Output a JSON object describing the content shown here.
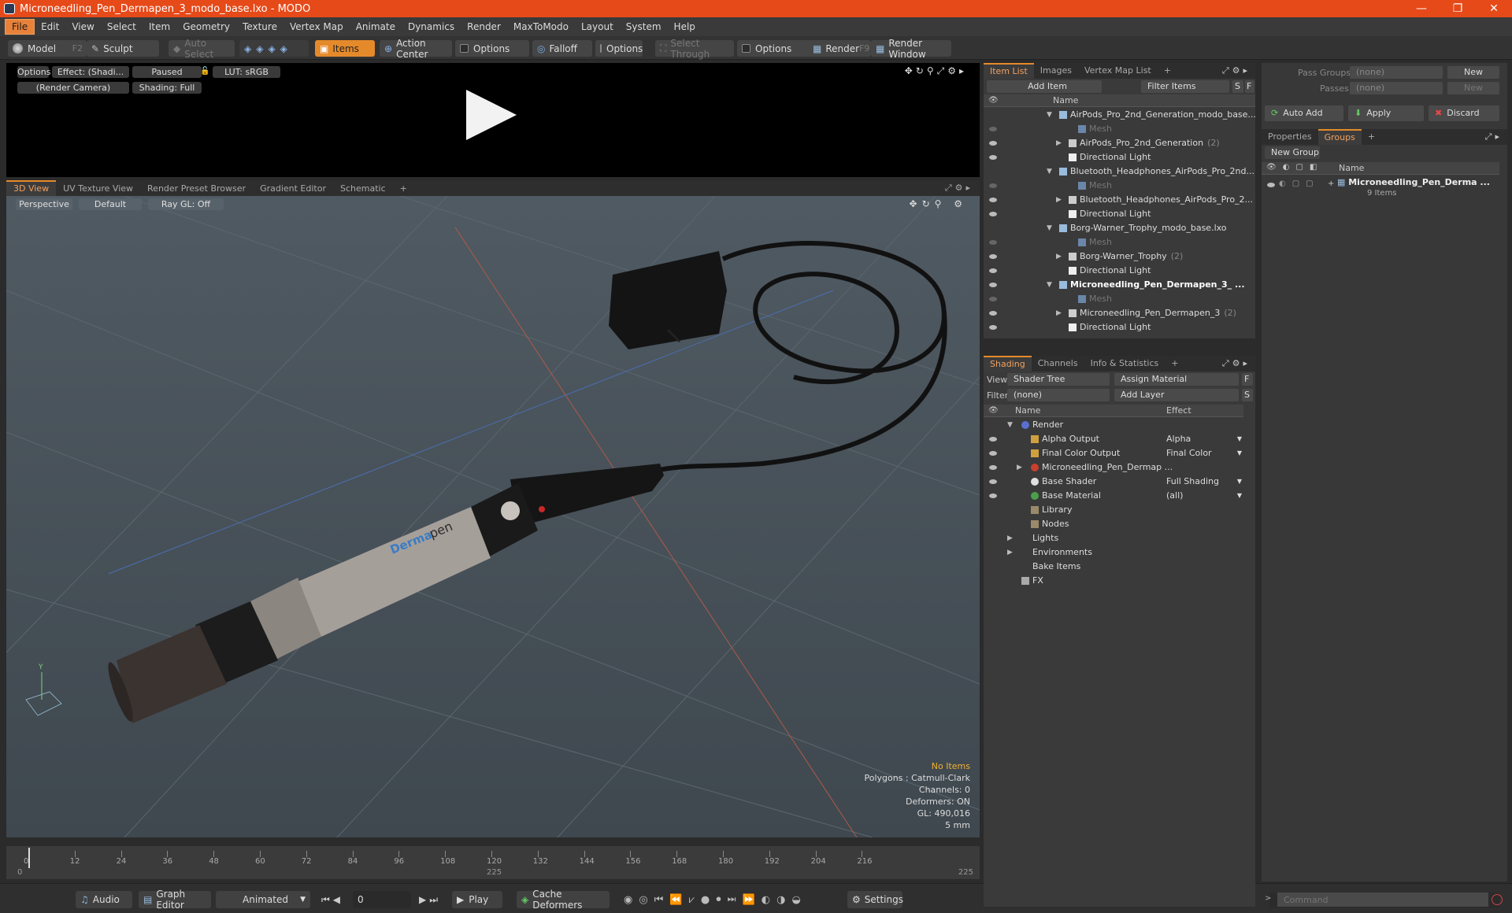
{
  "window": {
    "title": "Microneedling_Pen_Dermapen_3_modo_base.lxo - MODO",
    "minimize": "—",
    "maximize": "❐",
    "close": "✕"
  },
  "menu": [
    "File",
    "Edit",
    "View",
    "Select",
    "Item",
    "Geometry",
    "Texture",
    "Vertex Map",
    "Animate",
    "Dynamics",
    "Render",
    "MaxToModo",
    "Layout",
    "System",
    "Help"
  ],
  "toolbar": {
    "model": "Model",
    "model_key": "F2",
    "sculpt": "Sculpt",
    "auto_select": "Auto Select",
    "items": "Items",
    "action_center": "Action Center",
    "options1": "Options",
    "falloff": "Falloff",
    "options2": "Options",
    "select_through": "Select Through",
    "options3": "Options",
    "render": "Render",
    "render_key": "F9",
    "render_window": "Render Window"
  },
  "preview": {
    "options": "Options",
    "effect": "Effect: (Shadi...",
    "paused": "Paused",
    "lut": "LUT: sRGB",
    "camera": "(Render Camera)",
    "shading": "Shading: Full"
  },
  "view_tabs": [
    "3D View",
    "UV Texture View",
    "Render Preset Browser",
    "Gradient Editor",
    "Schematic",
    "+"
  ],
  "viewport": {
    "perspective": "Perspective",
    "default": "Default",
    "raygl": "Ray GL: Off",
    "info": {
      "items": "No Items",
      "polygons": "Polygons : Catmull-Clark",
      "channels": "Channels: 0",
      "deformers": "Deformers: ON",
      "gl": "GL: 490,016",
      "unit": "5 mm"
    },
    "product_brand1": "Derma",
    "product_brand2": "pen"
  },
  "timeline": {
    "ticks": [
      "0",
      "12",
      "24",
      "36",
      "48",
      "60",
      "72",
      "84",
      "96",
      "108",
      "120",
      "132",
      "144",
      "156",
      "168",
      "180",
      "192",
      "204",
      "216"
    ],
    "start": "0",
    "mid": "225",
    "end": "225"
  },
  "bottombar": {
    "audio": "Audio",
    "graph_editor": "Graph Editor",
    "animated": "Animated",
    "frame": "0",
    "play": "Play",
    "cache": "Cache Deformers",
    "settings": "Settings"
  },
  "item_list": {
    "tabs": [
      "Item List",
      "Images",
      "Vertex Map List",
      "+"
    ],
    "add_item": "Add Item",
    "filter": "Filter Items",
    "s": "S",
    "f": "F",
    "col_name": "Name",
    "rows": [
      {
        "label": "AirPods_Pro_2nd_Generation_modo_base...",
        "indent": 0,
        "type": "scene",
        "eye": false
      },
      {
        "label": "Mesh",
        "indent": 2,
        "type": "mesh",
        "eye": true,
        "dim": true
      },
      {
        "label": "AirPods_Pro_2nd_Generation",
        "count": "(2)",
        "indent": 1,
        "type": "group",
        "eye": true
      },
      {
        "label": "Directional Light",
        "indent": 1,
        "type": "light",
        "eye": true
      },
      {
        "label": "Bluetooth_Headphones_AirPods_Pro_2nd...",
        "indent": 0,
        "type": "scene",
        "eye": false
      },
      {
        "label": "Mesh",
        "indent": 2,
        "type": "mesh",
        "eye": true,
        "dim": true
      },
      {
        "label": "Bluetooth_Headphones_AirPods_Pro_2...",
        "indent": 1,
        "type": "group",
        "eye": true
      },
      {
        "label": "Directional Light",
        "indent": 1,
        "type": "light",
        "eye": true
      },
      {
        "label": "Borg-Warner_Trophy_modo_base.lxo",
        "indent": 0,
        "type": "scene",
        "eye": false
      },
      {
        "label": "Mesh",
        "indent": 2,
        "type": "mesh",
        "eye": true,
        "dim": true
      },
      {
        "label": "Borg-Warner_Trophy",
        "count": "(2)",
        "indent": 1,
        "type": "group",
        "eye": true
      },
      {
        "label": "Directional Light",
        "indent": 1,
        "type": "light",
        "eye": true
      },
      {
        "label": "Microneedling_Pen_Dermapen_3_ ...",
        "indent": 0,
        "type": "scene",
        "eye": true,
        "bold": true
      },
      {
        "label": "Mesh",
        "indent": 2,
        "type": "mesh",
        "eye": true,
        "dim": true
      },
      {
        "label": "Microneedling_Pen_Dermapen_3",
        "count": "(2)",
        "indent": 1,
        "type": "group",
        "eye": true
      },
      {
        "label": "Directional Light",
        "indent": 1,
        "type": "light",
        "eye": true
      }
    ]
  },
  "shading": {
    "tabs": [
      "Shading",
      "Channels",
      "Info & Statistics",
      "+"
    ],
    "view_label": "View",
    "view_value": "Shader Tree",
    "assign": "Assign Material",
    "f": "F",
    "filter_label": "Filter",
    "filter_value": "(none)",
    "add_layer": "Add Layer",
    "s": "S",
    "col_name": "Name",
    "col_effect": "Effect",
    "rows": [
      {
        "name": "Render",
        "effect": "",
        "indent": 0,
        "eye": false,
        "icon": "render"
      },
      {
        "name": "Alpha Output",
        "effect": "Alpha",
        "indent": 1,
        "eye": true,
        "icon": "output"
      },
      {
        "name": "Final Color Output",
        "effect": "Final Color",
        "indent": 1,
        "eye": true,
        "icon": "output"
      },
      {
        "name": "Microneedling_Pen_Dermap ...",
        "effect": "",
        "indent": 1,
        "eye": true,
        "icon": "material"
      },
      {
        "name": "Base Shader",
        "effect": "Full Shading",
        "indent": 1,
        "eye": true,
        "icon": "shader"
      },
      {
        "name": "Base Material",
        "effect": "(all)",
        "indent": 1,
        "eye": true,
        "icon": "basemat"
      },
      {
        "name": "Library",
        "effect": "",
        "indent": 1,
        "eye": false,
        "icon": "folder"
      },
      {
        "name": "Nodes",
        "effect": "",
        "indent": 1,
        "eye": false,
        "icon": "folder"
      },
      {
        "name": "Lights",
        "effect": "",
        "indent": 0,
        "eye": false,
        "icon": "none"
      },
      {
        "name": "Environments",
        "effect": "",
        "indent": 0,
        "eye": false,
        "icon": "none"
      },
      {
        "name": "Bake Items",
        "effect": "",
        "indent": 0,
        "eye": false,
        "icon": "none"
      },
      {
        "name": "FX",
        "effect": "",
        "indent": 0,
        "eye": false,
        "icon": "fx"
      }
    ]
  },
  "groups": {
    "pass_groups_label": "Pass Groups",
    "pass_groups_value": "(none)",
    "new1": "New",
    "passes_label": "Passes",
    "passes_value": "(none)",
    "new2": "New",
    "auto_add": "Auto Add",
    "apply": "Apply",
    "discard": "Discard",
    "tabs": [
      "Properties",
      "Groups",
      "+"
    ],
    "new_group": "New Group",
    "col_name": "Name",
    "item_name": "Microneedling_Pen_Derma ...",
    "item_count": "9 Items"
  },
  "command": {
    "placeholder": "Command"
  },
  "colors": {
    "accent": "#e58a2b",
    "title_bar": "#e64a19"
  }
}
